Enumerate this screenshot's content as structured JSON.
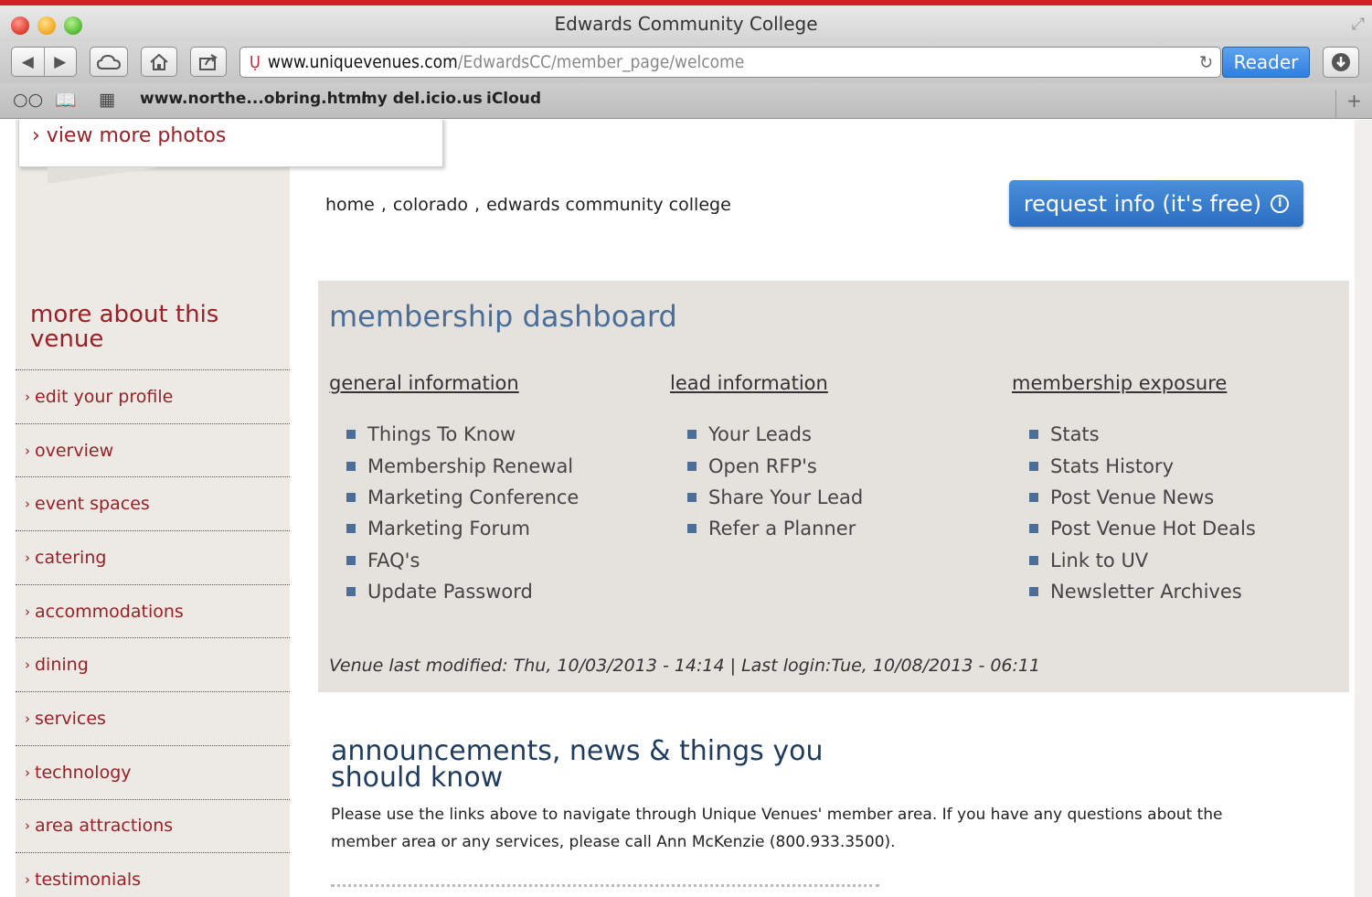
{
  "window": {
    "title": "Edwards Community College"
  },
  "toolbar": {
    "url_host": "www.uniquevenues.com",
    "url_path": "/EdwardsCC/member_page/welcome",
    "reader_label": "Reader"
  },
  "bookmarks": [
    "www.northe...obring.html",
    "my del.icio.us",
    "iCloud"
  ],
  "photo_link": "view more photos",
  "breadcrumb": {
    "home": "home",
    "state": "colorado",
    "venue": "edwards community college",
    "sep": ","
  },
  "request_button": "request info (it's free)",
  "sidebar": {
    "title": "more about this venue",
    "items": [
      "edit your profile",
      "overview",
      "event spaces",
      "catering",
      "accommodations",
      "dining",
      "services",
      "technology",
      "area attractions",
      "testimonials"
    ]
  },
  "dashboard": {
    "title": "membership dashboard",
    "columns": [
      {
        "heading": "general information",
        "items": [
          "Things To Know",
          "Membership Renewal",
          "Marketing Conference",
          "Marketing Forum",
          "FAQ's",
          "Update Password"
        ]
      },
      {
        "heading": "lead information",
        "items": [
          "Your Leads",
          "Open RFP's",
          "Share Your Lead",
          "Refer a Planner"
        ]
      },
      {
        "heading": "membership exposure",
        "items": [
          "Stats",
          "Stats History",
          "Post Venue News",
          "Post Venue Hot Deals",
          "Link to UV",
          "Newsletter Archives"
        ]
      }
    ],
    "modified": "Venue last modified: Thu, 10/03/2013 - 14:14 | Last login:Tue, 10/08/2013 - 06:11"
  },
  "announcements": {
    "title": "announcements, news & things you should know",
    "text": "Please use the links above to navigate through Unique Venues' member area. If you have any questions about the member area or any services, please call Ann McKenzie (800.933.3500)."
  },
  "colors": {
    "accent_red": "#9b1f25",
    "dashboard_blue": "#4a6e98",
    "button_blue": "#2a6ec2"
  }
}
